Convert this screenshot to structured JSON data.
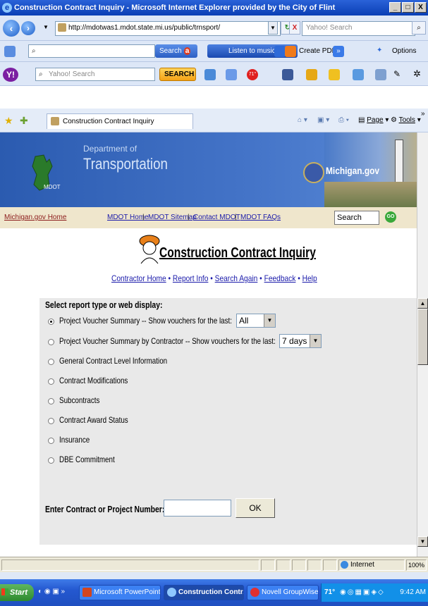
{
  "window": {
    "title": "Construction Contract Inquiry - Microsoft Internet Explorer provided by the City of Flint",
    "minimize": "_",
    "maximize": "□",
    "close": "X"
  },
  "navbar": {
    "address": "http://mdotwas1.mdot.state.mi.us/public/trnsport/",
    "search_placeholder": "Yahoo! Search"
  },
  "toolbar_ask": {
    "search_label": "Search",
    "listen_label": "Listen to music",
    "create_pdf_label": "Create PDF",
    "options_label": "Options"
  },
  "toolbar_yahoo": {
    "search_placeholder": "Yahoo! Search",
    "search_button": "SEARCH",
    "weather_badge": "71°"
  },
  "tabs": {
    "active_tab": "Construction Contract Inquiry",
    "page_label": "Page",
    "tools_label": "Tools"
  },
  "banner": {
    "dept_line1": "Department of",
    "dept_line2": "Transportation",
    "logo_text": "MDOT",
    "michigan_gov": "Michigan.gov"
  },
  "nav_links": {
    "home": "Michigan.gov Home",
    "mdot_home": "MDOT Home",
    "sitemap": "MDOT Sitemap",
    "contact": "Contact MDOT",
    "faqs": "MDOT FAQs",
    "search_value": "Search",
    "go": "GO",
    "sep": "|"
  },
  "page": {
    "heading": "Construction Contract Inquiry",
    "links": [
      "Contractor Home",
      "Report Info",
      "Search Again",
      "Feedback",
      "Help"
    ],
    "dot": "•"
  },
  "form": {
    "prompt": "Select report type or web display:",
    "options": [
      {
        "label": "Project Voucher Summary  --  Show vouchers for the last:",
        "selected": true,
        "select_value": "All"
      },
      {
        "label": "Project Voucher Summary by Contractor  --  Show vouchers for the last:",
        "selected": false,
        "select_value": "7 days"
      },
      {
        "label": "General Contract Level Information",
        "selected": false
      },
      {
        "label": "Contract Modifications",
        "selected": false
      },
      {
        "label": "Subcontracts",
        "selected": false
      },
      {
        "label": "Contract Award Status",
        "selected": false
      },
      {
        "label": "Insurance",
        "selected": false
      },
      {
        "label": "DBE Commitment",
        "selected": false
      }
    ],
    "number_label": "Enter Contract or Project Number:",
    "number_value": "",
    "ok_label": "OK"
  },
  "status": {
    "zone": "Internet",
    "zoom": "100%"
  },
  "taskbar": {
    "start": "Start",
    "items": [
      "Microsoft PowerPoint...",
      "Construction Contr...",
      "Novell GroupWise - M..."
    ],
    "temperature": "71°",
    "clock": "9:42 AM"
  },
  "colors": {
    "title_bar": "#0a3fb5",
    "banner": "#2b5bb0",
    "nav_strip": "#efe6cc",
    "form_bg": "#e9e9e9",
    "link": "#1a1aaa"
  }
}
